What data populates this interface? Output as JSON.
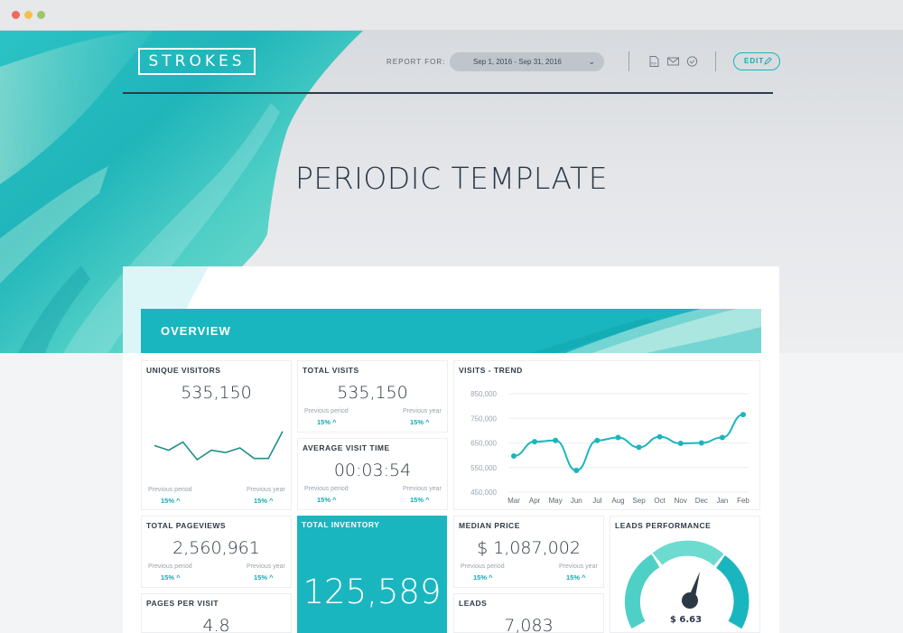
{
  "window": {
    "controls": [
      "close",
      "minimize",
      "maximize"
    ]
  },
  "header": {
    "logo_text": "STROKES",
    "report_for_label": "REPORT FOR:",
    "date_range": "Sep 1, 2016 - Sep 31, 2016",
    "icons": [
      "pdf-icon",
      "email-icon",
      "check-circle-icon"
    ],
    "edit_label": "EDIT"
  },
  "title": "PERIODIC TEMPLATE",
  "overview_label": "OVERVIEW",
  "colors": {
    "accent": "#1ab6bf",
    "dark": "#2e3a46"
  },
  "cards": {
    "unique_visitors": {
      "title": "UNIQUE VISITORS",
      "value": "535,150",
      "prev_label": "Previous period",
      "prev_value": "15%",
      "year_label": "Previous year",
      "year_value": "15%",
      "sparkline": [
        42,
        38,
        45,
        30,
        38,
        36,
        40,
        31,
        31,
        54
      ]
    },
    "total_visits": {
      "title": "TOTAL VISITS",
      "value": "535,150",
      "prev_label": "Previous period",
      "prev_value": "15%",
      "year_label": "Previous year",
      "year_value": "15%"
    },
    "avg_visit_time": {
      "title": "AVERAGE VISIT TIME",
      "value": "00:03:54",
      "prev_label": "Previous period",
      "prev_value": "15%",
      "year_label": "Previous year",
      "year_value": "15%"
    },
    "total_pageviews": {
      "title": "TOTAL PAGEVIEWS",
      "value": "2,560,961",
      "prev_label": "Previous period",
      "prev_value": "15%",
      "year_label": "Previous year",
      "year_value": "15%"
    },
    "total_inventory": {
      "title": "TOTAL INVENTORY",
      "value": "125,589"
    },
    "median_price": {
      "title": "MEDIAN PRICE",
      "value": "$ 1,087,002",
      "prev_label": "Previous period",
      "prev_value": "15%",
      "year_label": "Previous year",
      "year_value": "15%"
    },
    "leads_performance": {
      "title": "LEADS PERFORMANCE",
      "value": "$ 6.63"
    },
    "pages_per_visit": {
      "title": "PAGES PER VISIT",
      "value": "4.8"
    },
    "leads": {
      "title": "LEADS",
      "value": "7,083"
    }
  },
  "chart_data": {
    "type": "line",
    "title": "VISITS - TREND",
    "categories": [
      "Mar",
      "Apr",
      "May",
      "Jun",
      "Jul",
      "Aug",
      "Sep",
      "Oct",
      "Nov",
      "Dec",
      "Jan",
      "Feb"
    ],
    "values": [
      597000,
      655000,
      660000,
      538000,
      660000,
      672000,
      632000,
      675000,
      648000,
      650000,
      672000,
      765000
    ],
    "yticks": [
      "850,000",
      "750,000",
      "650,000",
      "550,000",
      "450,000"
    ],
    "ylim": [
      450000,
      850000
    ],
    "grid": true
  }
}
